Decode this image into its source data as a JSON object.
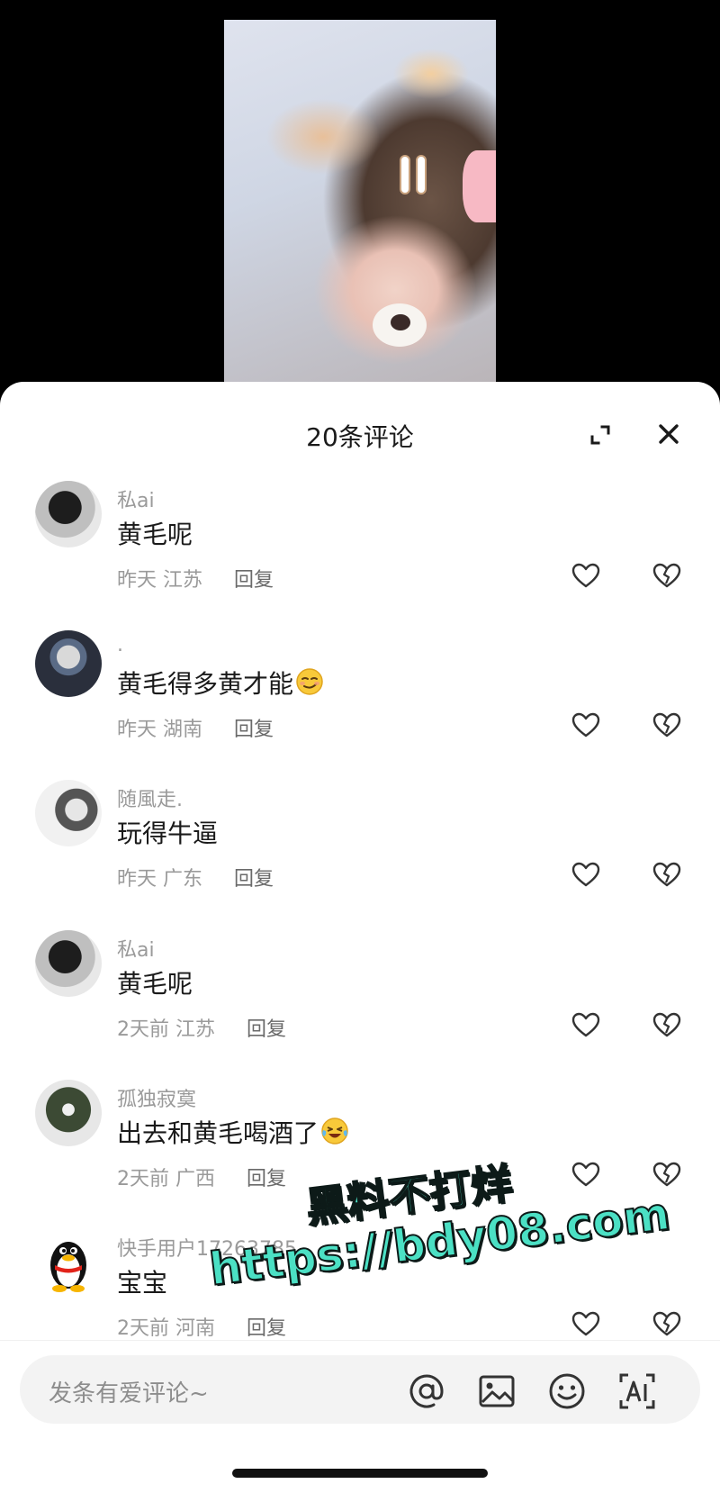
{
  "sheet": {
    "title": "20条评论"
  },
  "comments": [
    {
      "username": "私ai",
      "content": "黄毛呢",
      "emoji": "",
      "time": "昨天",
      "location": "江苏",
      "reply": "回复"
    },
    {
      "username": ".",
      "content": "黄毛得多黄才能",
      "emoji": "smirk-emoji",
      "time": "昨天",
      "location": "湖南",
      "reply": "回复"
    },
    {
      "username": "随風走.",
      "content": "玩得牛逼",
      "emoji": "",
      "time": "昨天",
      "location": "广东",
      "reply": "回复"
    },
    {
      "username": "私ai",
      "content": "黄毛呢",
      "emoji": "",
      "time": "2天前",
      "location": "江苏",
      "reply": "回复"
    },
    {
      "username": "孤独寂寞",
      "content": "出去和黄毛喝酒了",
      "emoji": "laugh-cry-emoji",
      "time": "2天前",
      "location": "广西",
      "reply": "回复"
    },
    {
      "username": "快手用户17263785",
      "content": "宝宝",
      "emoji": "",
      "time": "2天前",
      "location": "河南",
      "reply": "回复"
    }
  ],
  "watermark": {
    "line1": "黑料不打烊",
    "line2": "https://bdy08.com"
  },
  "input": {
    "placeholder": "发条有爱评论~"
  },
  "icons": [
    "expand-icon",
    "close-icon",
    "heart-icon",
    "broken-heart-icon",
    "at-icon",
    "image-icon",
    "emoji-icon",
    "ai-icon"
  ],
  "colors": {
    "watermark": "#4be0c4",
    "text": "#1a1a1a",
    "meta": "#9a9a9a"
  }
}
